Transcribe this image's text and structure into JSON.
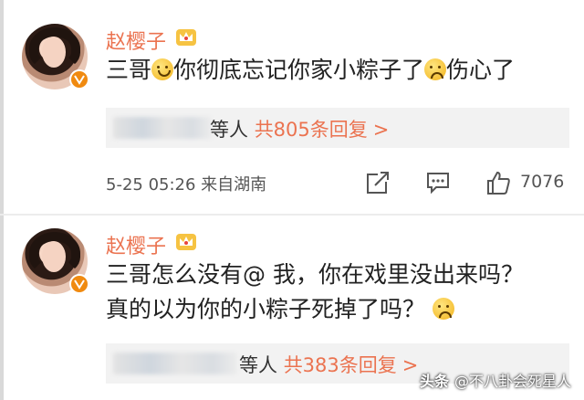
{
  "comments": [
    {
      "username": "赵樱子",
      "text_parts": [
        "三哥",
        "你彻底忘记你家小粽子了",
        "伤心了"
      ],
      "replies": {
        "suffix": "等人",
        "count_text": "共805条回复",
        "chevron": ">"
      },
      "timestamp": "5-25 05:26 来自湖南",
      "like_count": "7076"
    },
    {
      "username": "赵樱子",
      "line1": "三哥怎么没有@ 我，你在戏里没出来吗？",
      "line2": "真的以为你的小粽子死掉了吗？",
      "replies": {
        "suffix": "等人",
        "count_text": "共383条回复",
        "chevron": ">"
      }
    }
  ],
  "watermark": {
    "prefix": "头条",
    "handle": "@不八卦会死星人"
  },
  "icons": [
    "verified-v-icon",
    "crown-icon",
    "smile-emoji-icon",
    "sad-emoji-icon",
    "share-icon",
    "comment-icon",
    "like-icon",
    "fearful-emoji-icon"
  ],
  "colors": {
    "username": "#eb7350",
    "reply_count": "#eb7350",
    "verified_badge": "#f08a10"
  }
}
